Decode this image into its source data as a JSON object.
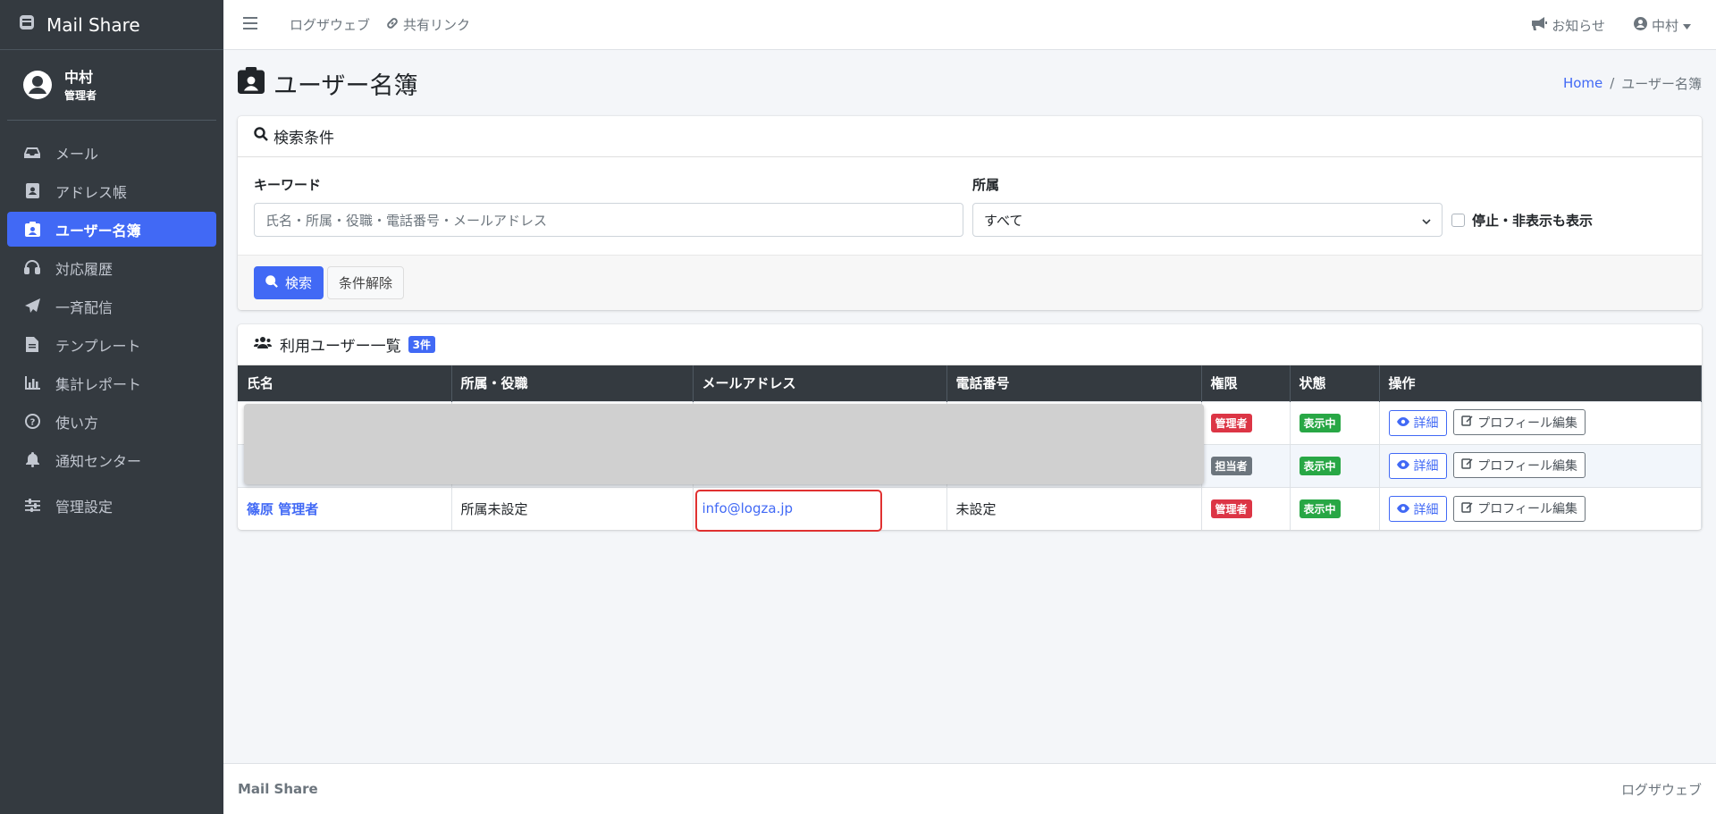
{
  "brand": {
    "name": "Mail Share",
    "icon": "mail-share-logo-icon"
  },
  "user": {
    "name": "中村",
    "role": "管理者"
  },
  "sidebar": {
    "items": [
      {
        "label": "メール",
        "icon": "inbox-icon"
      },
      {
        "label": "アドレス帳",
        "icon": "address-book-icon"
      },
      {
        "label": "ユーザー名簿",
        "icon": "id-badge-icon",
        "active": true
      },
      {
        "label": "対応履歴",
        "icon": "headset-icon"
      },
      {
        "label": "一斉配信",
        "icon": "paper-plane-icon"
      },
      {
        "label": "テンプレート",
        "icon": "file-icon"
      },
      {
        "label": "集計レポート",
        "icon": "bar-chart-icon"
      },
      {
        "label": "使い方",
        "icon": "question-icon"
      },
      {
        "label": "通知センター",
        "icon": "bell-icon"
      },
      {
        "label": "管理設定",
        "icon": "sliders-icon"
      }
    ]
  },
  "topbar": {
    "links": [
      {
        "label": "ログザウェブ"
      },
      {
        "label": "共有リンク",
        "icon": "link-icon"
      }
    ],
    "notifications_label": "お知らせ",
    "user_label": "中村"
  },
  "page": {
    "title": "ユーザー名簿",
    "breadcrumb": {
      "home": "Home",
      "current": "ユーザー名簿"
    }
  },
  "search": {
    "title": "検索条件",
    "keyword_label": "キーワード",
    "keyword_placeholder": "氏名・所属・役職・電話番号・メールアドレス",
    "affiliation_label": "所属",
    "affiliation_value": "すべて",
    "show_inactive_label": "停止・非表示も表示",
    "search_button": "検索",
    "clear_button": "条件解除"
  },
  "users": {
    "title": "利用ユーザー一覧",
    "count": "3件",
    "columns": [
      "氏名",
      "所属・役職",
      "メールアドレス",
      "電話番号",
      "権限",
      "状態",
      "操作"
    ],
    "detail_button": "詳細",
    "edit_button": "プロフィール編集",
    "rows": [
      {
        "name": "",
        "affiliation": "",
        "email": "",
        "phone": "",
        "role": "管理者",
        "status": "表示中"
      },
      {
        "name": "",
        "affiliation": "",
        "email": "",
        "phone": "",
        "role": "担当者",
        "status": "表示中"
      },
      {
        "name": "篠原 管理者",
        "affiliation": "所属未設定",
        "email": "info@logza.jp",
        "phone": "未設定",
        "role": "管理者",
        "status": "表示中"
      }
    ]
  },
  "footer": {
    "left": "Mail Share",
    "right": "ログザウェブ"
  },
  "colors": {
    "primary": "#4169f5",
    "sidebar": "#343a40",
    "danger": "#dc3545",
    "success": "#28a745"
  }
}
